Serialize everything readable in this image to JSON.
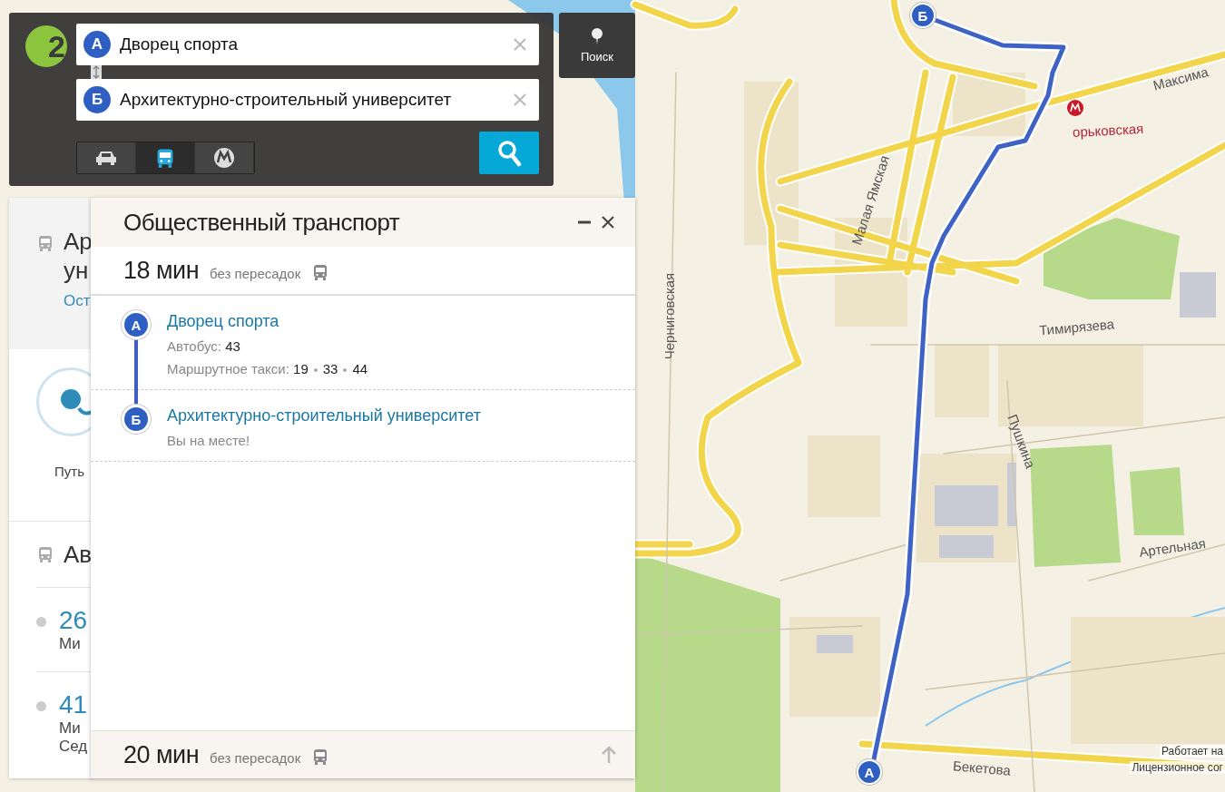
{
  "map": {
    "labels": [
      "Черниговская",
      "Малая Ямская",
      "Максима",
      "орьковская",
      "Тимирязева",
      "Пушкина",
      "Артельная",
      "Бекетова"
    ],
    "markers": [
      {
        "letter": "Б"
      },
      {
        "letter": "А"
      }
    ],
    "attribution": [
      "Работает на",
      "Лицензионное сог"
    ]
  },
  "route_search": {
    "logo": "2",
    "from": {
      "marker": "А",
      "value": "Дворец спорта"
    },
    "to": {
      "marker": "Б",
      "value": "Архитектурно-строительный университет"
    },
    "modes": [
      {
        "kind": "car",
        "selected": false
      },
      {
        "kind": "bus",
        "selected": true
      },
      {
        "kind": "metro",
        "selected": false
      }
    ]
  },
  "search_button": {
    "label": "Поиск"
  },
  "place_card": {
    "title_lines": [
      "Ар",
      "ун"
    ],
    "link": "Ост",
    "route_caption": "Путь",
    "section_title": "Ав",
    "routes": [
      {
        "number": "26",
        "lines": [
          "Ми"
        ]
      },
      {
        "number": "41",
        "lines": [
          "Ми",
          "Сед"
        ]
      }
    ]
  },
  "transport_panel": {
    "title": "Общественный транспорт",
    "routes": [
      {
        "duration": "18 мин",
        "transfers": "без пересадок",
        "expanded": true,
        "stops": [
          {
            "marker": "А",
            "name": "Дворец спорта",
            "lines": [
              {
                "label": "Автобус:",
                "numbers": [
                  "43"
                ]
              },
              {
                "label": "Маршрутное такси:",
                "numbers": [
                  "19",
                  "33",
                  "44"
                ]
              }
            ]
          },
          {
            "marker": "Б",
            "name": "Архитектурно-строительный университет",
            "note": "Вы на месте!"
          }
        ]
      },
      {
        "duration": "20 мин",
        "transfers": "без пересадок",
        "expanded": false
      }
    ]
  }
}
